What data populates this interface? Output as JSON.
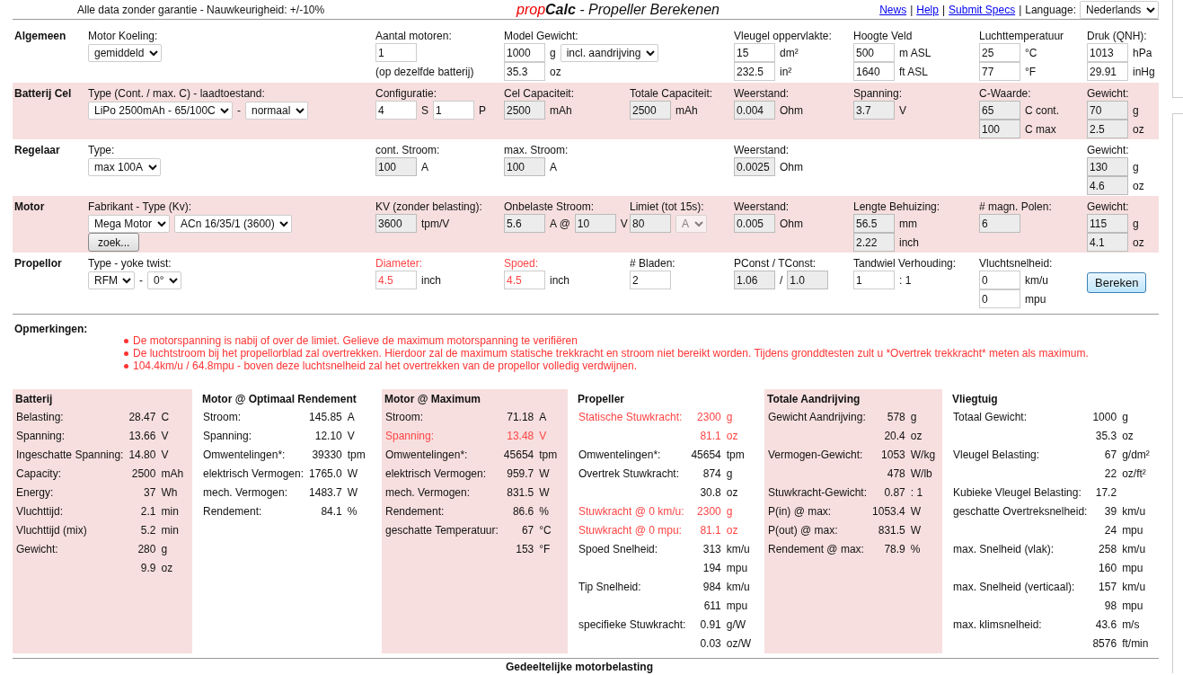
{
  "header": {
    "disclaimer": "Alle data zonder garantie - Nauwkeurigheid: +/-10%",
    "title_parts": [
      {
        "text": "prop",
        "kind": "accent"
      },
      {
        "text": "Calc",
        "kind": "strong"
      },
      {
        "text": " - Propeller Berekenen",
        "kind": "plain"
      }
    ],
    "links": [
      "News",
      "Help",
      "Submit Specs"
    ],
    "separator": "|",
    "language_label": "Language:",
    "language": "Nederlands"
  },
  "sections": [
    {
      "title": "Algemeen",
      "shaded": false,
      "cells": [
        {
          "label": "Motor Koeling:",
          "warn": false,
          "lines": [
            [
              {
                "kind": "select",
                "value": "gemiddeld",
                "disabled": false
              }
            ]
          ]
        },
        {
          "label": "Aantal motoren:",
          "warn": false,
          "lines": [
            [
              {
                "kind": "input",
                "value": "1",
                "readonly": false
              }
            ],
            [
              {
                "kind": "text",
                "text": "(op dezelfde batterij)"
              }
            ]
          ]
        },
        {
          "label": "Model Gewicht:",
          "warn": false,
          "lines": [
            [
              {
                "kind": "input",
                "value": "1000",
                "readonly": false
              },
              {
                "kind": "text",
                "text": "g"
              },
              {
                "kind": "select",
                "value": "incl. aandrijving",
                "disabled": false
              }
            ],
            [
              {
                "kind": "input",
                "value": "35.3",
                "readonly": false
              },
              {
                "kind": "text",
                "text": "oz"
              }
            ]
          ]
        },
        {
          "label": "Vleugel oppervlakte:",
          "warn": false,
          "lines": [
            [
              {
                "kind": "input",
                "value": "15",
                "readonly": false
              },
              {
                "kind": "text",
                "text": "dm²"
              }
            ],
            [
              {
                "kind": "input",
                "value": "232.5",
                "readonly": false
              },
              {
                "kind": "text",
                "text": "in²"
              }
            ]
          ]
        },
        {
          "label": "Hoogte Veld",
          "warn": false,
          "lines": [
            [
              {
                "kind": "input",
                "value": "500",
                "readonly": false
              },
              {
                "kind": "text",
                "text": "m ASL"
              }
            ],
            [
              {
                "kind": "input",
                "value": "1640",
                "readonly": false
              },
              {
                "kind": "text",
                "text": "ft ASL"
              }
            ]
          ]
        },
        {
          "label": "Luchttemperatuur",
          "warn": false,
          "lines": [
            [
              {
                "kind": "input",
                "value": "25",
                "readonly": false
              },
              {
                "kind": "text",
                "text": "°C"
              }
            ],
            [
              {
                "kind": "input",
                "value": "77",
                "readonly": false
              },
              {
                "kind": "text",
                "text": "°F"
              }
            ]
          ]
        },
        {
          "label": "Druk (QNH):",
          "warn": false,
          "lines": [
            [
              {
                "kind": "input",
                "value": "1013",
                "readonly": false
              },
              {
                "kind": "text",
                "text": "hPa"
              }
            ],
            [
              {
                "kind": "input",
                "value": "29.91",
                "readonly": false
              },
              {
                "kind": "text",
                "text": "inHg"
              }
            ]
          ]
        }
      ]
    },
    {
      "title": "Batterij Cel",
      "shaded": true,
      "cells": [
        {
          "label": "Type (Cont. / max. C) - laadtoestand:",
          "warn": false,
          "lines": [
            [
              {
                "kind": "select",
                "value": "LiPo 2500mAh - 65/100C",
                "disabled": false
              },
              {
                "kind": "text",
                "text": "-"
              },
              {
                "kind": "select",
                "value": "normaal",
                "disabled": false
              }
            ]
          ]
        },
        {
          "label": "Configuratie:",
          "warn": false,
          "lines": [
            [
              {
                "kind": "input",
                "value": "4",
                "readonly": false
              },
              {
                "kind": "text",
                "text": "S"
              },
              {
                "kind": "input",
                "value": "1",
                "readonly": false
              },
              {
                "kind": "text",
                "text": "P"
              }
            ]
          ]
        },
        {
          "label": "Cel Capaciteit:",
          "warn": false,
          "lines": [
            [
              {
                "kind": "input",
                "value": "2500",
                "readonly": true
              },
              {
                "kind": "text",
                "text": "mAh"
              }
            ]
          ]
        },
        {
          "label": "Totale Capaciteit:",
          "warn": false,
          "lines": [
            [
              {
                "kind": "input",
                "value": "2500",
                "readonly": true
              },
              {
                "kind": "text",
                "text": "mAh"
              }
            ]
          ]
        },
        {
          "label": "Weerstand:",
          "warn": false,
          "lines": [
            [
              {
                "kind": "input",
                "value": "0.004",
                "readonly": true
              },
              {
                "kind": "text",
                "text": "Ohm"
              }
            ]
          ]
        },
        {
          "label": "Spanning:",
          "warn": false,
          "lines": [
            [
              {
                "kind": "input",
                "value": "3.7",
                "readonly": true
              },
              {
                "kind": "text",
                "text": "V"
              }
            ]
          ]
        },
        {
          "label": "C-Waarde:",
          "warn": false,
          "lines": [
            [
              {
                "kind": "input",
                "value": "65",
                "readonly": true
              },
              {
                "kind": "text",
                "text": "C cont."
              }
            ],
            [
              {
                "kind": "input",
                "value": "100",
                "readonly": true
              },
              {
                "kind": "text",
                "text": "C max"
              }
            ]
          ]
        },
        {
          "label": "Gewicht:",
          "warn": false,
          "lines": [
            [
              {
                "kind": "input",
                "value": "70",
                "readonly": true
              },
              {
                "kind": "text",
                "text": "g"
              }
            ],
            [
              {
                "kind": "input",
                "value": "2.5",
                "readonly": true
              },
              {
                "kind": "text",
                "text": "oz"
              }
            ]
          ]
        }
      ]
    },
    {
      "title": "Regelaar",
      "shaded": false,
      "cells": [
        {
          "label": "Type:",
          "warn": false,
          "lines": [
            [
              {
                "kind": "select",
                "value": "max 100A",
                "disabled": false
              }
            ]
          ]
        },
        {
          "label": "cont. Stroom:",
          "warn": false,
          "lines": [
            [
              {
                "kind": "input",
                "value": "100",
                "readonly": true
              },
              {
                "kind": "text",
                "text": "A"
              }
            ]
          ]
        },
        {
          "label": "max. Stroom:",
          "warn": false,
          "lines": [
            [
              {
                "kind": "input",
                "value": "100",
                "readonly": true
              },
              {
                "kind": "text",
                "text": "A"
              }
            ]
          ]
        },
        {
          "label": "Weerstand:",
          "warn": false,
          "lines": [
            [
              {
                "kind": "input",
                "value": "0.0025",
                "readonly": true
              },
              {
                "kind": "text",
                "text": "Ohm"
              }
            ]
          ]
        },
        {
          "label": "Gewicht:",
          "warn": false,
          "lines": [
            [
              {
                "kind": "input",
                "value": "130",
                "readonly": true
              },
              {
                "kind": "text",
                "text": "g"
              }
            ],
            [
              {
                "kind": "input",
                "value": "4.6",
                "readonly": true
              },
              {
                "kind": "text",
                "text": "oz"
              }
            ]
          ]
        }
      ]
    },
    {
      "title": "Motor",
      "shaded": true,
      "cells": [
        {
          "label": "Fabrikant - Type (Kv):",
          "warn": false,
          "lines": [
            [
              {
                "kind": "select",
                "value": "Mega Motor",
                "disabled": false
              },
              {
                "kind": "select",
                "value": "ACn 16/35/1 (3600)",
                "disabled": false
              }
            ],
            [
              {
                "kind": "button",
                "text": "zoek..."
              }
            ]
          ]
        },
        {
          "label": "KV (zonder belasting):",
          "warn": false,
          "lines": [
            [
              {
                "kind": "input",
                "value": "3600",
                "readonly": true
              },
              {
                "kind": "text",
                "text": "tpm/V"
              }
            ]
          ]
        },
        {
          "label": "Onbelaste Stroom:",
          "warn": false,
          "lines": [
            [
              {
                "kind": "input",
                "value": "5.6",
                "readonly": true
              },
              {
                "kind": "text",
                "text": "A @"
              },
              {
                "kind": "input",
                "value": "10",
                "readonly": true
              },
              {
                "kind": "text",
                "text": "V"
              }
            ]
          ]
        },
        {
          "label": "Limiet (tot 15s):",
          "warn": false,
          "lines": [
            [
              {
                "kind": "input",
                "value": "80",
                "readonly": true
              },
              {
                "kind": "select",
                "value": "A",
                "disabled": true
              }
            ]
          ]
        },
        {
          "label": "Weerstand:",
          "warn": false,
          "lines": [
            [
              {
                "kind": "input",
                "value": "0.005",
                "readonly": true
              },
              {
                "kind": "text",
                "text": "Ohm"
              }
            ]
          ]
        },
        {
          "label": "Lengte Behuizing:",
          "warn": false,
          "lines": [
            [
              {
                "kind": "input",
                "value": "56.5",
                "readonly": true
              },
              {
                "kind": "text",
                "text": "mm"
              }
            ],
            [
              {
                "kind": "input",
                "value": "2.22",
                "readonly": true
              },
              {
                "kind": "text",
                "text": "inch"
              }
            ]
          ]
        },
        {
          "label": "# magn. Polen:",
          "warn": false,
          "lines": [
            [
              {
                "kind": "input",
                "value": "6",
                "readonly": true
              }
            ]
          ]
        },
        {
          "label": "Gewicht:",
          "warn": false,
          "lines": [
            [
              {
                "kind": "input",
                "value": "115",
                "readonly": true
              },
              {
                "kind": "text",
                "text": "g"
              }
            ],
            [
              {
                "kind": "input",
                "value": "4.1",
                "readonly": true
              },
              {
                "kind": "text",
                "text": "oz"
              }
            ]
          ]
        }
      ]
    },
    {
      "title": "Propellor",
      "shaded": false,
      "cells": [
        {
          "label": "Type - yoke twist:",
          "warn": false,
          "lines": [
            [
              {
                "kind": "select",
                "value": "RFM",
                "disabled": false
              },
              {
                "kind": "text",
                "text": "-"
              },
              {
                "kind": "select",
                "value": "0°",
                "disabled": false
              }
            ]
          ]
        },
        {
          "label": "Diameter:",
          "warn": true,
          "lines": [
            [
              {
                "kind": "input",
                "value": "4.5",
                "readonly": false
              },
              {
                "kind": "text",
                "text": "inch"
              }
            ]
          ]
        },
        {
          "label": "Spoed:",
          "warn": true,
          "lines": [
            [
              {
                "kind": "input",
                "value": "4.5",
                "readonly": false
              },
              {
                "kind": "text",
                "text": "inch"
              }
            ]
          ]
        },
        {
          "label": "# Bladen:",
          "warn": false,
          "lines": [
            [
              {
                "kind": "input",
                "value": "2",
                "readonly": false
              }
            ]
          ]
        },
        {
          "label": "PConst / TConst:",
          "warn": false,
          "lines": [
            [
              {
                "kind": "input",
                "value": "1.06",
                "readonly": true
              },
              {
                "kind": "text",
                "text": "/"
              },
              {
                "kind": "input",
                "value": "1.0",
                "readonly": true
              }
            ]
          ]
        },
        {
          "label": "Tandwiel Verhouding:",
          "warn": false,
          "lines": [
            [
              {
                "kind": "input",
                "value": "1",
                "readonly": false
              },
              {
                "kind": "text",
                "text": ": 1"
              }
            ]
          ]
        },
        {
          "label": "Vluchtsnelheid:",
          "warn": false,
          "lines": [
            [
              {
                "kind": "input",
                "value": "0",
                "readonly": false
              },
              {
                "kind": "text",
                "text": "km/u"
              }
            ],
            [
              {
                "kind": "input",
                "value": "0",
                "readonly": false
              },
              {
                "kind": "text",
                "text": "mpu"
              }
            ]
          ]
        },
        {
          "lines": [
            [
              {
                "kind": "primary_button",
                "text": "Bereken"
              }
            ]
          ]
        }
      ]
    }
  ],
  "remarks": {
    "title": "Opmerkingen:",
    "items": [
      "De motorspanning is nabij of over de limiet. Gelieve de maximum motorspanning te verifiëren",
      "De luchtstroom bij het propellorblad zal overtrekken. Hierdoor zal de maximum statische trekkracht en stroom niet bereikt worden. Tijdens gronddtesten zult u *Overtrek trekkracht* meten als maximum.",
      "104.4km/u / 64.8mpu - boven deze luchtsnelheid zal het overtrekken van de propellor volledig verdwijnen."
    ]
  },
  "results": [
    {
      "title": "Batterij",
      "shaded": true,
      "rows": [
        {
          "label": "Belasting:",
          "value": "28.47",
          "unit": "C",
          "warn": false
        },
        {
          "label": "Spanning:",
          "value": "13.66",
          "unit": "V",
          "warn": false
        },
        {
          "label": "Ingeschatte Spanning:",
          "value": "14.80",
          "unit": "V",
          "warn": false
        },
        {
          "label": "Capacity:",
          "value": "2500",
          "unit": "mAh",
          "warn": false
        },
        {
          "label": "Energy:",
          "value": "37",
          "unit": "Wh",
          "warn": false
        },
        {
          "label": "Vluchttijd:",
          "value": "2.1",
          "unit": "min",
          "warn": false
        },
        {
          "label": "Vluchttijd (mix)",
          "value": "5.2",
          "unit": "min",
          "warn": false
        },
        {
          "label": "Gewicht:",
          "value": "280",
          "unit": "g",
          "warn": false
        },
        {
          "value": "9.9",
          "unit": "oz",
          "warn": false
        }
      ]
    },
    {
      "title": "Motor @ Optimaal Rendement",
      "shaded": false,
      "rows": [
        {
          "label": "Stroom:",
          "value": "145.85",
          "unit": "A",
          "warn": false
        },
        {
          "label": "Spanning:",
          "value": "12.10",
          "unit": "V",
          "warn": false
        },
        {
          "label": "Omwentelingen*:",
          "value": "39330",
          "unit": "tpm",
          "warn": false
        },
        {
          "label": "elektrisch Vermogen:",
          "value": "1765.0",
          "unit": "W",
          "warn": false
        },
        {
          "label": "mech. Vermogen:",
          "value": "1483.7",
          "unit": "W",
          "warn": false
        },
        {
          "label": "Rendement:",
          "value": "84.1",
          "unit": "%",
          "warn": false
        }
      ]
    },
    {
      "title": "Motor @ Maximum",
      "shaded": true,
      "rows": [
        {
          "label": "Stroom:",
          "value": "71.18",
          "unit": "A",
          "warn": false
        },
        {
          "label": "Spanning:",
          "value": "13.48",
          "unit": "V",
          "warn": true
        },
        {
          "label": "Omwentelingen*:",
          "value": "45654",
          "unit": "tpm",
          "warn": false
        },
        {
          "label": "elektrisch Vermogen:",
          "value": "959.7",
          "unit": "W",
          "warn": false
        },
        {
          "label": "mech. Vermogen:",
          "value": "831.5",
          "unit": "W",
          "warn": false
        },
        {
          "label": "Rendement:",
          "value": "86.6",
          "unit": "%",
          "warn": false
        },
        {
          "label": "geschatte Temperatuur:",
          "value": "67",
          "unit": "°C",
          "warn": false
        },
        {
          "value": "153",
          "unit": "°F",
          "warn": false
        }
      ]
    },
    {
      "title": "Propeller",
      "shaded": false,
      "rows": [
        {
          "label": "Statische Stuwkracht:",
          "value": "2300",
          "unit": "g",
          "warn": true
        },
        {
          "value": "81.1",
          "unit": "oz",
          "warn": true
        },
        {
          "label": "Omwentelingen*:",
          "value": "45654",
          "unit": "tpm",
          "warn": false
        },
        {
          "label": "Overtrek Stuwkracht:",
          "value": "874",
          "unit": "g",
          "warn": false
        },
        {
          "value": "30.8",
          "unit": "oz",
          "warn": false
        },
        {
          "label": "Stuwkracht @ 0 km/u:",
          "value": "2300",
          "unit": "g",
          "warn": true
        },
        {
          "label": "Stuwkracht @ 0 mpu:",
          "value": "81.1",
          "unit": "oz",
          "warn": true
        },
        {
          "label": "Spoed Snelheid:",
          "value": "313",
          "unit": "km/u",
          "warn": false
        },
        {
          "value": "194",
          "unit": "mpu",
          "warn": false
        },
        {
          "label": "Tip Snelheid:",
          "value": "984",
          "unit": "km/u",
          "warn": false
        },
        {
          "value": "611",
          "unit": "mpu",
          "warn": false
        },
        {
          "label": "specifieke Stuwkracht:",
          "value": "0.91",
          "unit": "g/W",
          "warn": false
        },
        {
          "value": "0.03",
          "unit": "oz/W",
          "warn": false
        }
      ]
    },
    {
      "title": "Totale Aandrijving",
      "shaded": true,
      "rows": [
        {
          "label": "Gewicht Aandrijving:",
          "value": "578",
          "unit": "g",
          "warn": false
        },
        {
          "value": "20.4",
          "unit": "oz",
          "warn": false
        },
        {
          "label": "Vermogen-Gewicht:",
          "value": "1053",
          "unit": "W/kg",
          "warn": false
        },
        {
          "value": "478",
          "unit": "W/lb",
          "warn": false
        },
        {
          "label": "Stuwkracht-Gewicht:",
          "value": "0.87",
          "unit": ": 1",
          "warn": false
        },
        {
          "label": "P(in) @ max:",
          "value": "1053.4",
          "unit": "W",
          "warn": false
        },
        {
          "label": "P(out) @ max:",
          "value": "831.5",
          "unit": "W",
          "warn": false
        },
        {
          "label": "Rendement @ max:",
          "value": "78.9",
          "unit": "%",
          "warn": false
        }
      ]
    },
    {
      "title": "Vliegtuig",
      "shaded": false,
      "rows": [
        {
          "label": "Totaal Gewicht:",
          "value": "1000",
          "unit": "g",
          "warn": false
        },
        {
          "value": "35.3",
          "unit": "oz",
          "warn": false
        },
        {
          "label": "Vleugel Belasting:",
          "value": "67",
          "unit": "g/dm²",
          "warn": false
        },
        {
          "value": "22",
          "unit": "oz/ft²",
          "warn": false
        },
        {
          "label": "Kubieke Vleugel Belasting:",
          "value": "17.2",
          "warn": false
        },
        {
          "label": "geschatte Overtreksnelheid:",
          "value": "39",
          "unit": "km/u",
          "warn": false
        },
        {
          "value": "24",
          "unit": "mpu",
          "warn": false
        },
        {
          "label": "max. Snelheid (vlak):",
          "value": "258",
          "unit": "km/u",
          "warn": false
        },
        {
          "value": "160",
          "unit": "mpu",
          "warn": false
        },
        {
          "label": "max. Snelheid (verticaal):",
          "value": "157",
          "unit": "km/u",
          "warn": false
        },
        {
          "value": "98",
          "unit": "mpu",
          "warn": false
        },
        {
          "label": "max. klimsnelheid:",
          "value": "43.6",
          "unit": "m/s",
          "warn": false
        },
        {
          "value": "8576",
          "unit": "ft/min",
          "warn": false
        }
      ]
    }
  ],
  "footer_heading": "Gedeeltelijke motorbelasting"
}
